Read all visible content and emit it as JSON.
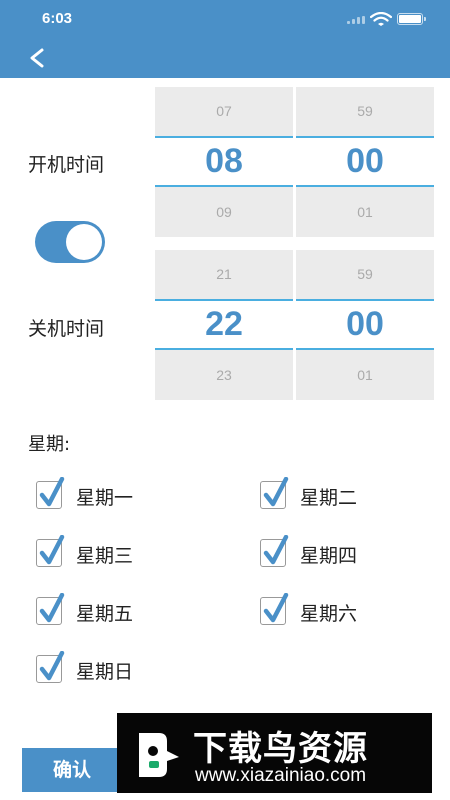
{
  "status_bar": {
    "time": "6:03"
  },
  "power_on": {
    "label": "开机时间",
    "hour": {
      "prev": "07",
      "current": "08",
      "next": "09"
    },
    "minute": {
      "prev": "59",
      "current": "00",
      "next": "01"
    }
  },
  "toggle": {
    "enabled": true
  },
  "power_off": {
    "label": "关机时间",
    "hour": {
      "prev": "21",
      "current": "22",
      "next": "23"
    },
    "minute": {
      "prev": "59",
      "current": "00",
      "next": "01"
    }
  },
  "week": {
    "label": "星期:",
    "days": [
      {
        "label": "星期一",
        "checked": true
      },
      {
        "label": "星期二",
        "checked": true
      },
      {
        "label": "星期三",
        "checked": true
      },
      {
        "label": "星期四",
        "checked": true
      },
      {
        "label": "星期五",
        "checked": true
      },
      {
        "label": "星期六",
        "checked": true
      },
      {
        "label": "星期日",
        "checked": true
      }
    ]
  },
  "confirm_label": "确认",
  "watermark": {
    "title": "下载鸟资源",
    "url": "www.xiazainiao.com"
  },
  "colors": {
    "primary": "#4a90c8",
    "picker_line": "#4aaee0",
    "picker_bg": "#ebebeb"
  },
  "icons": {
    "back": "chevron-left-icon",
    "check": "check-icon",
    "wifi": "wifi-icon",
    "battery": "battery-icon",
    "signal": "signal-icon"
  }
}
